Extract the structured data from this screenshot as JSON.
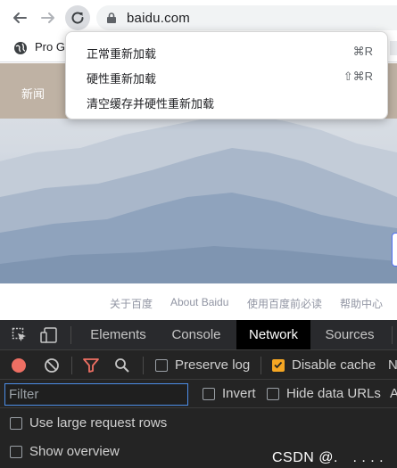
{
  "browser": {
    "url": "baidu.com",
    "bookmark_label": "Pro Gi"
  },
  "reload_menu": {
    "items": [
      {
        "label": "正常重新加载",
        "shortcut": "⌘R"
      },
      {
        "label": "硬性重新加载",
        "shortcut": "⇧⌘R"
      },
      {
        "label": "清空缓存并硬性重新加载",
        "shortcut": ""
      }
    ]
  },
  "page": {
    "nav_link": "新闻",
    "footer_links": [
      "关于百度",
      "About Baidu",
      "使用百度前必读",
      "帮助中心"
    ]
  },
  "devtools": {
    "tabs": [
      {
        "label": "Elements",
        "active": false
      },
      {
        "label": "Console",
        "active": false
      },
      {
        "label": "Network",
        "active": true
      },
      {
        "label": "Sources",
        "active": false
      }
    ],
    "network_toolbar": {
      "preserve_log": {
        "label": "Preserve log",
        "checked": false
      },
      "disable_cache": {
        "label": "Disable cache",
        "checked": true
      },
      "overflow_label": "N"
    },
    "filter_bar": {
      "placeholder": "Filter",
      "invert": {
        "label": "Invert",
        "checked": false
      },
      "hide_data_urls": {
        "label": "Hide data URLs",
        "checked": false
      },
      "overflow_label": "A"
    },
    "options": {
      "large_rows": {
        "label": "Use large request rows",
        "checked": false
      },
      "show_overview": {
        "label": "Show overview",
        "checked": false
      }
    },
    "watermark": "CSDN @.　. . . ."
  },
  "colors": {
    "record": "#ee6f63",
    "filter_active": "#ee6f63",
    "checkbox_checked": "#f5a623",
    "active_tab_bg": "#000000",
    "focus_border": "#4d8ee8"
  }
}
